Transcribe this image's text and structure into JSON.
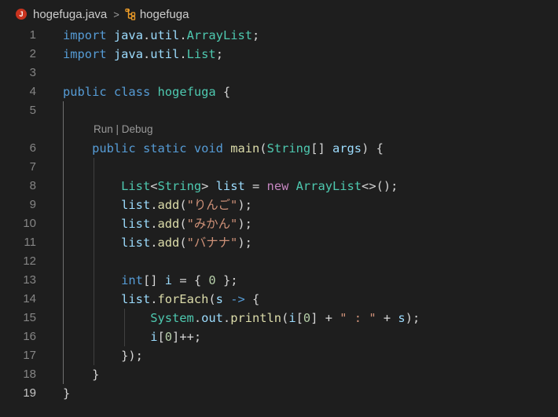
{
  "breadcrumb": {
    "file": "hogefuga.java",
    "file_icon": "java-icon",
    "separator": ">",
    "symbol": "hogefuga",
    "symbol_icon": "class-icon"
  },
  "codelens": {
    "run": "Run",
    "divider": " | ",
    "debug": "Debug"
  },
  "lines": [
    {
      "n": "1",
      "tokens": [
        [
          "kw",
          "import"
        ],
        [
          "pn",
          " "
        ],
        [
          "vr",
          "java"
        ],
        [
          "pn",
          "."
        ],
        [
          "vr",
          "util"
        ],
        [
          "pn",
          "."
        ],
        [
          "ty",
          "ArrayList"
        ],
        [
          "pn",
          ";"
        ]
      ]
    },
    {
      "n": "2",
      "tokens": [
        [
          "kw",
          "import"
        ],
        [
          "pn",
          " "
        ],
        [
          "vr",
          "java"
        ],
        [
          "pn",
          "."
        ],
        [
          "vr",
          "util"
        ],
        [
          "pn",
          "."
        ],
        [
          "ty",
          "List"
        ],
        [
          "pn",
          ";"
        ]
      ]
    },
    {
      "n": "3",
      "tokens": []
    },
    {
      "n": "4",
      "tokens": [
        [
          "kw",
          "public"
        ],
        [
          "pn",
          " "
        ],
        [
          "kw",
          "class"
        ],
        [
          "pn",
          " "
        ],
        [
          "ty",
          "hogefuga"
        ],
        [
          "pn",
          " {"
        ]
      ]
    },
    {
      "n": "5",
      "tokens": []
    },
    {
      "n": "6",
      "tokens": [
        [
          "pn",
          "    "
        ],
        [
          "kw",
          "public"
        ],
        [
          "pn",
          " "
        ],
        [
          "kw",
          "static"
        ],
        [
          "pn",
          " "
        ],
        [
          "kw",
          "void"
        ],
        [
          "pn",
          " "
        ],
        [
          "fn",
          "main"
        ],
        [
          "pn",
          "("
        ],
        [
          "ty",
          "String"
        ],
        [
          "pn",
          "[] "
        ],
        [
          "vr",
          "args"
        ],
        [
          "pn",
          ") {"
        ]
      ]
    },
    {
      "n": "7",
      "tokens": []
    },
    {
      "n": "8",
      "tokens": [
        [
          "pn",
          "        "
        ],
        [
          "ty",
          "List"
        ],
        [
          "pn",
          "<"
        ],
        [
          "ty",
          "String"
        ],
        [
          "pn",
          "> "
        ],
        [
          "vr",
          "list"
        ],
        [
          "pn",
          " = "
        ],
        [
          "kw2",
          "new"
        ],
        [
          "pn",
          " "
        ],
        [
          "ty",
          "ArrayList"
        ],
        [
          "pn",
          "<>();"
        ]
      ]
    },
    {
      "n": "9",
      "tokens": [
        [
          "pn",
          "        "
        ],
        [
          "vr",
          "list"
        ],
        [
          "pn",
          "."
        ],
        [
          "fn",
          "add"
        ],
        [
          "pn",
          "("
        ],
        [
          "st",
          "\"りんご\""
        ],
        [
          "pn",
          ");"
        ]
      ]
    },
    {
      "n": "10",
      "tokens": [
        [
          "pn",
          "        "
        ],
        [
          "vr",
          "list"
        ],
        [
          "pn",
          "."
        ],
        [
          "fn",
          "add"
        ],
        [
          "pn",
          "("
        ],
        [
          "st",
          "\"みかん\""
        ],
        [
          "pn",
          ");"
        ]
      ]
    },
    {
      "n": "11",
      "tokens": [
        [
          "pn",
          "        "
        ],
        [
          "vr",
          "list"
        ],
        [
          "pn",
          "."
        ],
        [
          "fn",
          "add"
        ],
        [
          "pn",
          "("
        ],
        [
          "st",
          "\"バナナ\""
        ],
        [
          "pn",
          ");"
        ]
      ]
    },
    {
      "n": "12",
      "tokens": []
    },
    {
      "n": "13",
      "tokens": [
        [
          "pn",
          "        "
        ],
        [
          "kw",
          "int"
        ],
        [
          "pn",
          "[] "
        ],
        [
          "vr",
          "i"
        ],
        [
          "pn",
          " = { "
        ],
        [
          "nm",
          "0"
        ],
        [
          "pn",
          " };"
        ]
      ]
    },
    {
      "n": "14",
      "tokens": [
        [
          "pn",
          "        "
        ],
        [
          "vr",
          "list"
        ],
        [
          "pn",
          "."
        ],
        [
          "fn",
          "forEach"
        ],
        [
          "pn",
          "("
        ],
        [
          "vr",
          "s"
        ],
        [
          "pn",
          " "
        ],
        [
          "kw",
          "->"
        ],
        [
          "pn",
          " {"
        ]
      ]
    },
    {
      "n": "15",
      "tokens": [
        [
          "pn",
          "            "
        ],
        [
          "ty",
          "System"
        ],
        [
          "pn",
          "."
        ],
        [
          "vr",
          "out"
        ],
        [
          "pn",
          "."
        ],
        [
          "fn",
          "println"
        ],
        [
          "pn",
          "("
        ],
        [
          "vr",
          "i"
        ],
        [
          "pn",
          "["
        ],
        [
          "nm",
          "0"
        ],
        [
          "pn",
          "] + "
        ],
        [
          "st",
          "\" : \""
        ],
        [
          "pn",
          " + "
        ],
        [
          "vr",
          "s"
        ],
        [
          "pn",
          ");"
        ]
      ]
    },
    {
      "n": "16",
      "tokens": [
        [
          "pn",
          "            "
        ],
        [
          "vr",
          "i"
        ],
        [
          "pn",
          "["
        ],
        [
          "nm",
          "0"
        ],
        [
          "pn",
          "]++;"
        ]
      ]
    },
    {
      "n": "17",
      "tokens": [
        [
          "pn",
          "        });"
        ]
      ]
    },
    {
      "n": "18",
      "tokens": [
        [
          "pn",
          "    }"
        ]
      ]
    },
    {
      "n": "19",
      "tokens": [
        [
          "pn",
          "}"
        ]
      ],
      "active": true
    }
  ]
}
